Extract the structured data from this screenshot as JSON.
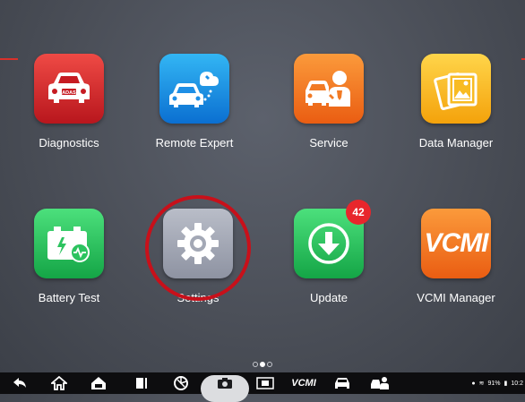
{
  "apps_row1": [
    {
      "label": "Diagnostics",
      "color": "#d6262a",
      "icon": "car-adas-icon",
      "adas_text": "ADAS"
    },
    {
      "label": "Remote Expert",
      "color": "#1e8fe6",
      "icon": "car-cloud-wrench-icon"
    },
    {
      "label": "Service",
      "color": "#f17a24",
      "icon": "car-mechanic-icon"
    },
    {
      "label": "Data Manager",
      "color": "#f8bb22",
      "icon": "photo-gallery-icon"
    }
  ],
  "apps_row2": [
    {
      "label": "Battery Test",
      "color": "#2cc35f",
      "icon": "battery-icon"
    },
    {
      "label": "Settings",
      "color": "#a3a8b5",
      "icon": "gear-icon"
    },
    {
      "label": "Update",
      "color": "#2cc35f",
      "icon": "download-arrow-icon",
      "badge": "42"
    },
    {
      "label": "VCMI Manager",
      "color": "#f17a24",
      "icon": "vcmi-logo",
      "logo_text": "VCMI"
    }
  ],
  "highlight_color": "#c8101a",
  "page_indicator": {
    "total": 3,
    "active_index": 1
  },
  "navbar": {
    "items": [
      "back-icon",
      "home-icon",
      "car-home-icon",
      "recent-apps-icon",
      "browser-icon",
      "camera-icon",
      "screen-record-icon",
      "vcmi-nav-logo",
      "car-icon",
      "car-mechanic-nav-icon"
    ],
    "vcmi_text": "VCMI",
    "status": {
      "battery_percent": "91%",
      "time": "10:2"
    }
  }
}
